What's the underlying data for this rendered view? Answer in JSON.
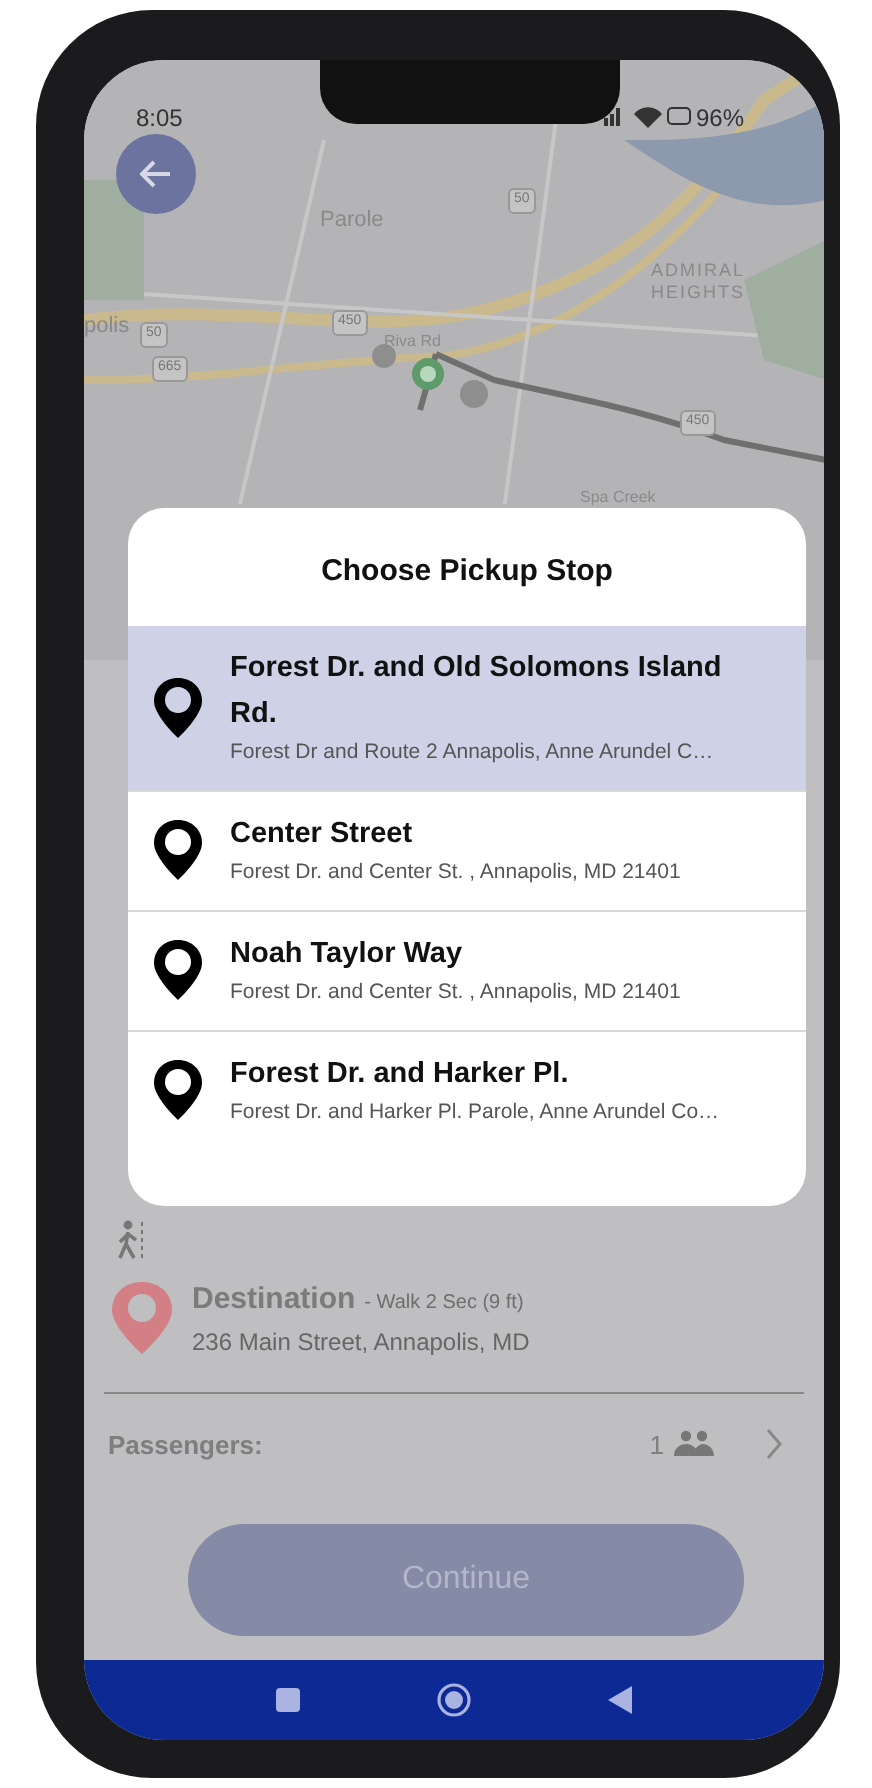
{
  "status_bar": {
    "time": "8:05",
    "battery": "96%"
  },
  "map": {
    "labels": [
      "Parole",
      "ADMIRAL HEIGHTS",
      "polis",
      "Riva Rd",
      "Spa Creek"
    ],
    "shields": [
      "50",
      "50",
      "450",
      "665",
      "450"
    ]
  },
  "trip": {
    "destination": {
      "title": "Destination",
      "note": "- Walk 2 Sec (9 ft)",
      "address": "236 Main Street, Annapolis, MD"
    }
  },
  "passengers": {
    "label": "Passengers:",
    "count": "1"
  },
  "continue_button": "Continue",
  "dialog": {
    "title": "Choose Pickup Stop",
    "stops": [
      {
        "name": "Forest Dr. and Old Solomons Island Rd.",
        "address": "Forest Dr and Route 2 Annapolis, Anne Arundel C…",
        "selected": true
      },
      {
        "name": "Center Street",
        "address": "Forest Dr. and Center St. , Annapolis, MD 21401",
        "selected": false
      },
      {
        "name": "Noah Taylor Way",
        "address": "Forest Dr. and Center St. , Annapolis, MD 21401",
        "selected": false
      },
      {
        "name": "Forest Dr. and Harker Pl.",
        "address": "Forest Dr. and Harker Pl. Parole, Anne Arundel Co…",
        "selected": false
      }
    ]
  }
}
